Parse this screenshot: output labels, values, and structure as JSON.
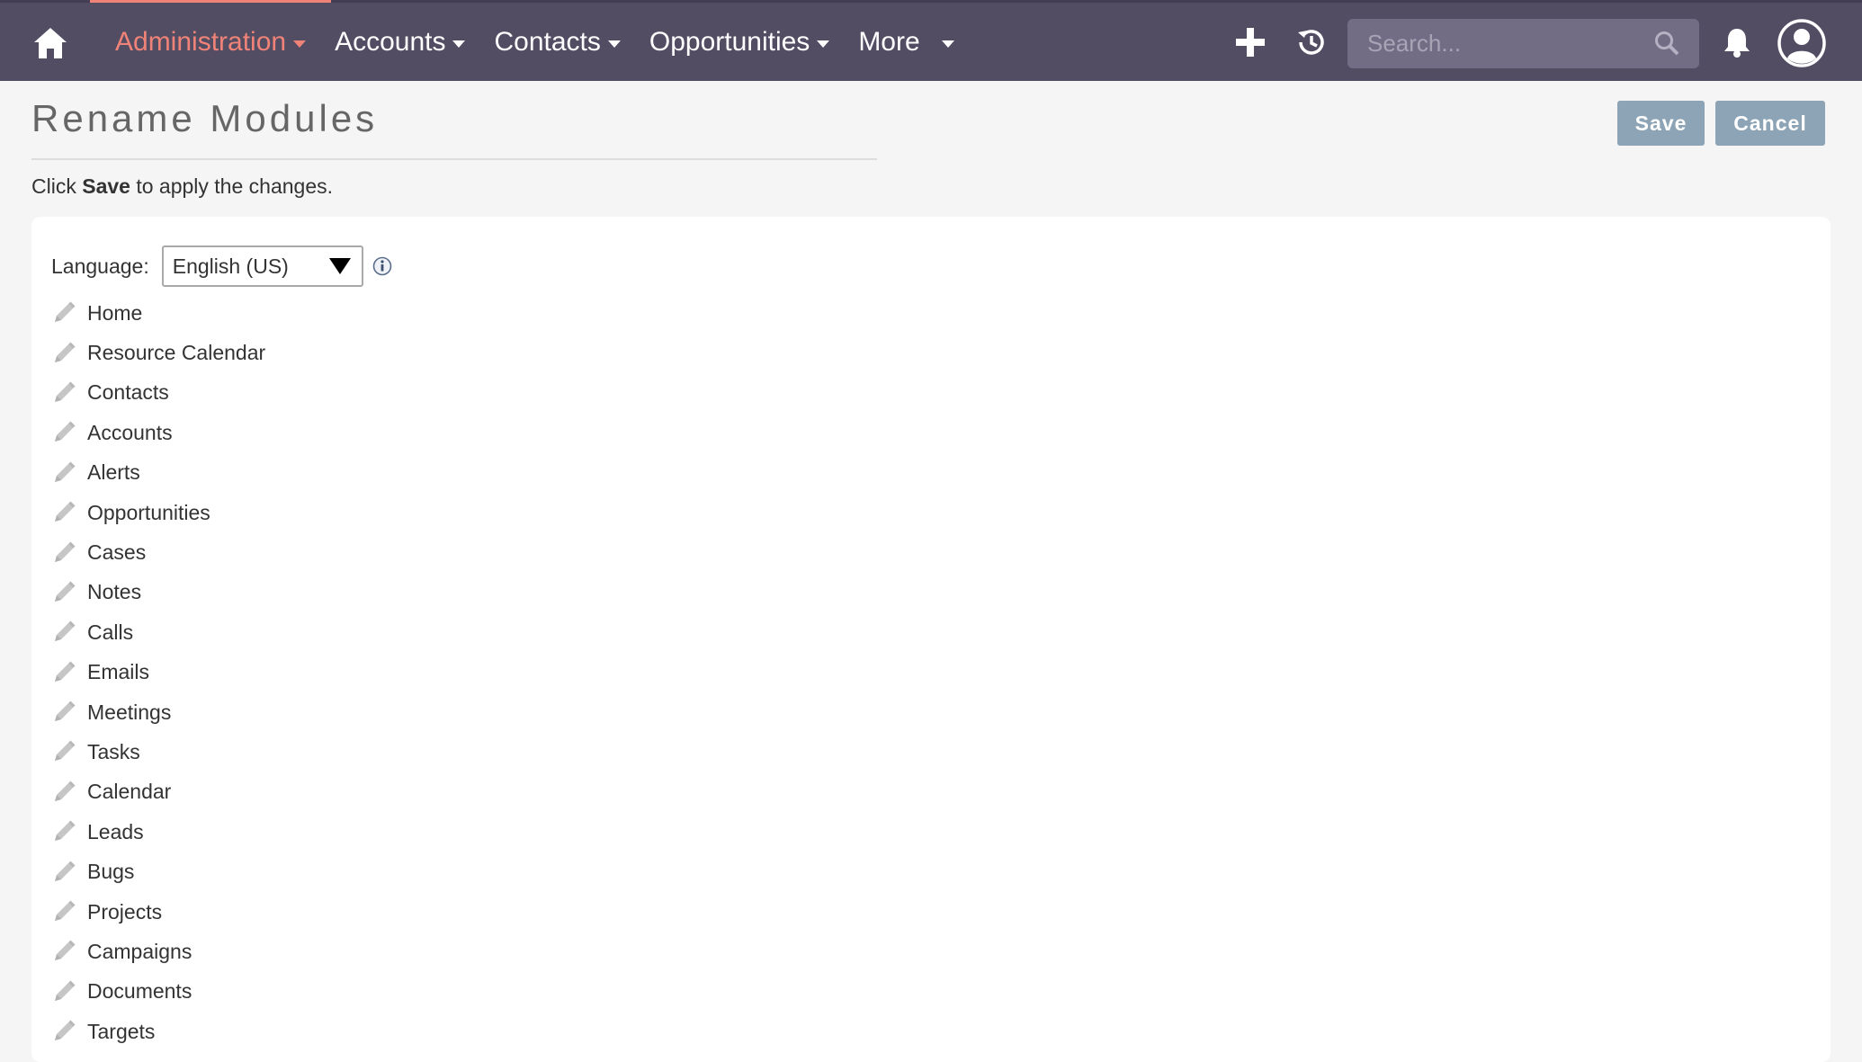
{
  "nav": {
    "items": [
      {
        "label": "Administration",
        "active": true,
        "name": "nav-administration"
      },
      {
        "label": "Accounts",
        "active": false,
        "name": "nav-accounts"
      },
      {
        "label": "Contacts",
        "active": false,
        "name": "nav-contacts"
      },
      {
        "label": "Opportunities",
        "active": false,
        "name": "nav-opportunities"
      },
      {
        "label": "More",
        "active": false,
        "name": "nav-more"
      }
    ],
    "search_placeholder": "Search..."
  },
  "header": {
    "title": "Rename Modules",
    "save_label": "Save",
    "cancel_label": "Cancel",
    "hint_prefix": "Click",
    "hint_bold": "Save",
    "hint_suffix": "to apply the changes."
  },
  "language": {
    "label": "Language:",
    "selected": "English (US)"
  },
  "modules": [
    "Home",
    "Resource Calendar",
    "Contacts",
    "Accounts",
    "Alerts",
    "Opportunities",
    "Cases",
    "Notes",
    "Calls",
    "Emails",
    "Meetings",
    "Tasks",
    "Calendar",
    "Leads",
    "Bugs",
    "Projects",
    "Campaigns",
    "Documents",
    "Targets"
  ],
  "colors": {
    "navbar": "#534d64",
    "active_nav": "#f08377",
    "button": "#8ca4b6"
  }
}
